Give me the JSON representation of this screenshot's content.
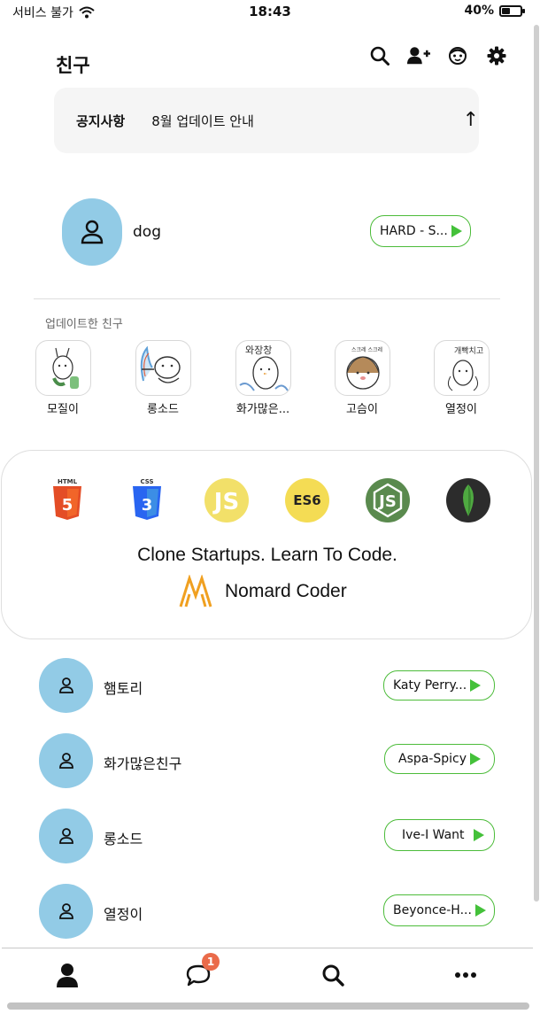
{
  "status_bar": {
    "carrier": "서비스 불가",
    "time": "18:43",
    "battery_percent": "40%",
    "battery_level": 0.4
  },
  "header": {
    "title": "친구",
    "icons": [
      "search-icon",
      "add-friend-icon",
      "face-icon",
      "gear-icon"
    ]
  },
  "notice": {
    "label": "공지사항",
    "text": "8월 업데이트 안내",
    "arrow": "↑"
  },
  "my_profile": {
    "name": "dog",
    "music": "HARD - S..."
  },
  "updated_friends": {
    "heading": "업데이트한 친구",
    "items": [
      {
        "name": "모질이"
      },
      {
        "name": "롱소드"
      },
      {
        "name": "화가많은..."
      },
      {
        "name": "고슴이"
      },
      {
        "name": "열정이"
      }
    ]
  },
  "ad": {
    "tagline": "Clone Startups. Learn To Code.",
    "brand": "Nomard Coder",
    "tech_icons": [
      {
        "name": "html5-icon",
        "label": "HTML",
        "color": "#e44d26"
      },
      {
        "name": "css3-icon",
        "label": "CSS",
        "color": "#2965f1"
      },
      {
        "name": "javascript-icon",
        "label": "JS",
        "color": "#f0db4f"
      },
      {
        "name": "es6-icon",
        "label": "ES6",
        "color": "#f4dc54"
      },
      {
        "name": "nodejs-icon",
        "label": "JS",
        "color": "#5a8a4e"
      },
      {
        "name": "mongodb-icon",
        "label": "",
        "color": "#2c2c2c"
      }
    ],
    "brand_color": "#f0a020"
  },
  "friends": [
    {
      "name": "햄토리",
      "music": "Katy Perry..."
    },
    {
      "name": "화가많은친구",
      "music": "Aspa-Spicy"
    },
    {
      "name": "롱소드",
      "music": "Ive-I Want"
    },
    {
      "name": "열정이",
      "music": "Beyonce-H..."
    }
  ],
  "tab_bar": {
    "tabs": [
      "person-icon",
      "chat-icon",
      "search-icon",
      "more-icon"
    ],
    "chat_badge": "1"
  },
  "colors": {
    "avatar_bg": "#92cbe6",
    "pill_border": "#4cbc3a",
    "play_green": "#44c13a",
    "badge": "#ea6b4a"
  }
}
